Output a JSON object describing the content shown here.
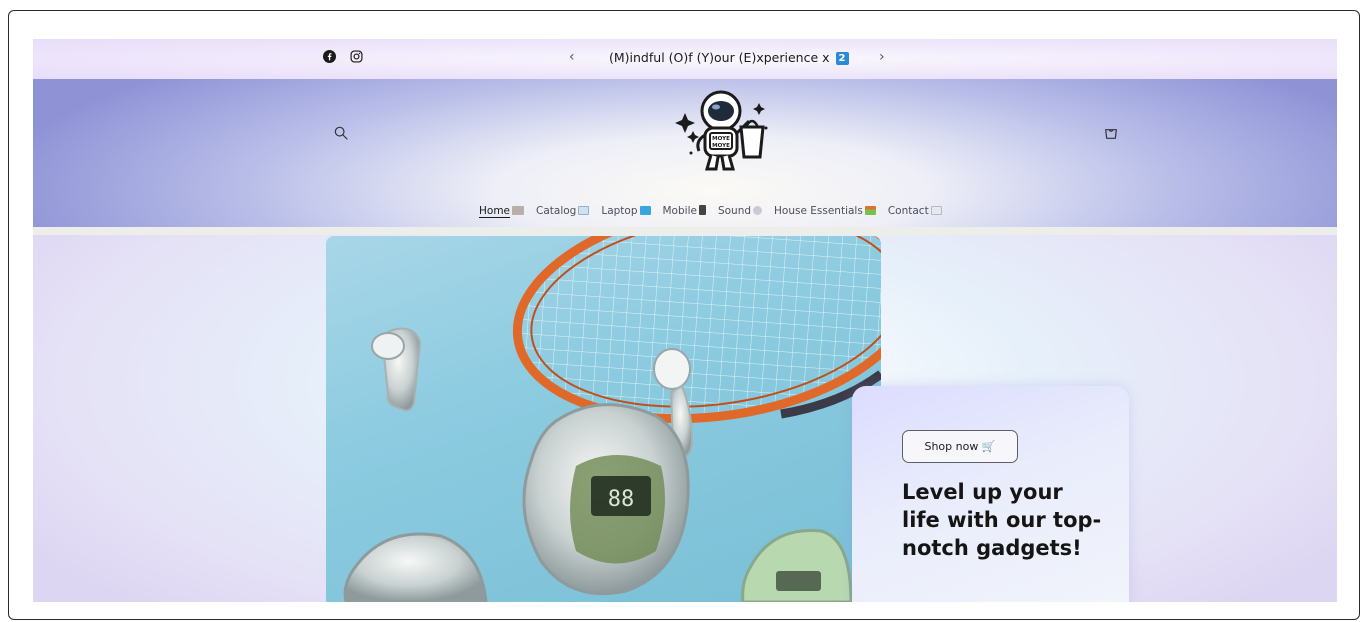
{
  "announcement": {
    "prev_label": "‹",
    "next_label": "›",
    "text": "(M)indful (O)f (Y)our (E)xperience x",
    "badge": "2",
    "social": [
      "facebook-icon",
      "instagram-icon"
    ]
  },
  "header": {
    "logo_text_top": "MOYE",
    "logo_text_bottom": "MOYE"
  },
  "nav": {
    "items": [
      {
        "label": "Home",
        "icon": "cart-emoji",
        "active": true
      },
      {
        "label": "Catalog",
        "icon": "book-emoji"
      },
      {
        "label": "Laptop",
        "icon": "laptop-emoji"
      },
      {
        "label": "Mobile",
        "icon": "phone-emoji"
      },
      {
        "label": "Sound",
        "icon": "speaker-emoji"
      },
      {
        "label": "House Essentials",
        "icon": "house-emoji"
      },
      {
        "label": "Contact",
        "icon": "envelope-emoji"
      }
    ]
  },
  "hero": {
    "shop_button": "Shop now 🛒",
    "headline": "Level up your life with our top-notch gadgets!"
  },
  "colors": {
    "accent_badge": "#2a8ad6",
    "header_edge": "#8f93d6",
    "racket_orange": "#e0692a"
  }
}
